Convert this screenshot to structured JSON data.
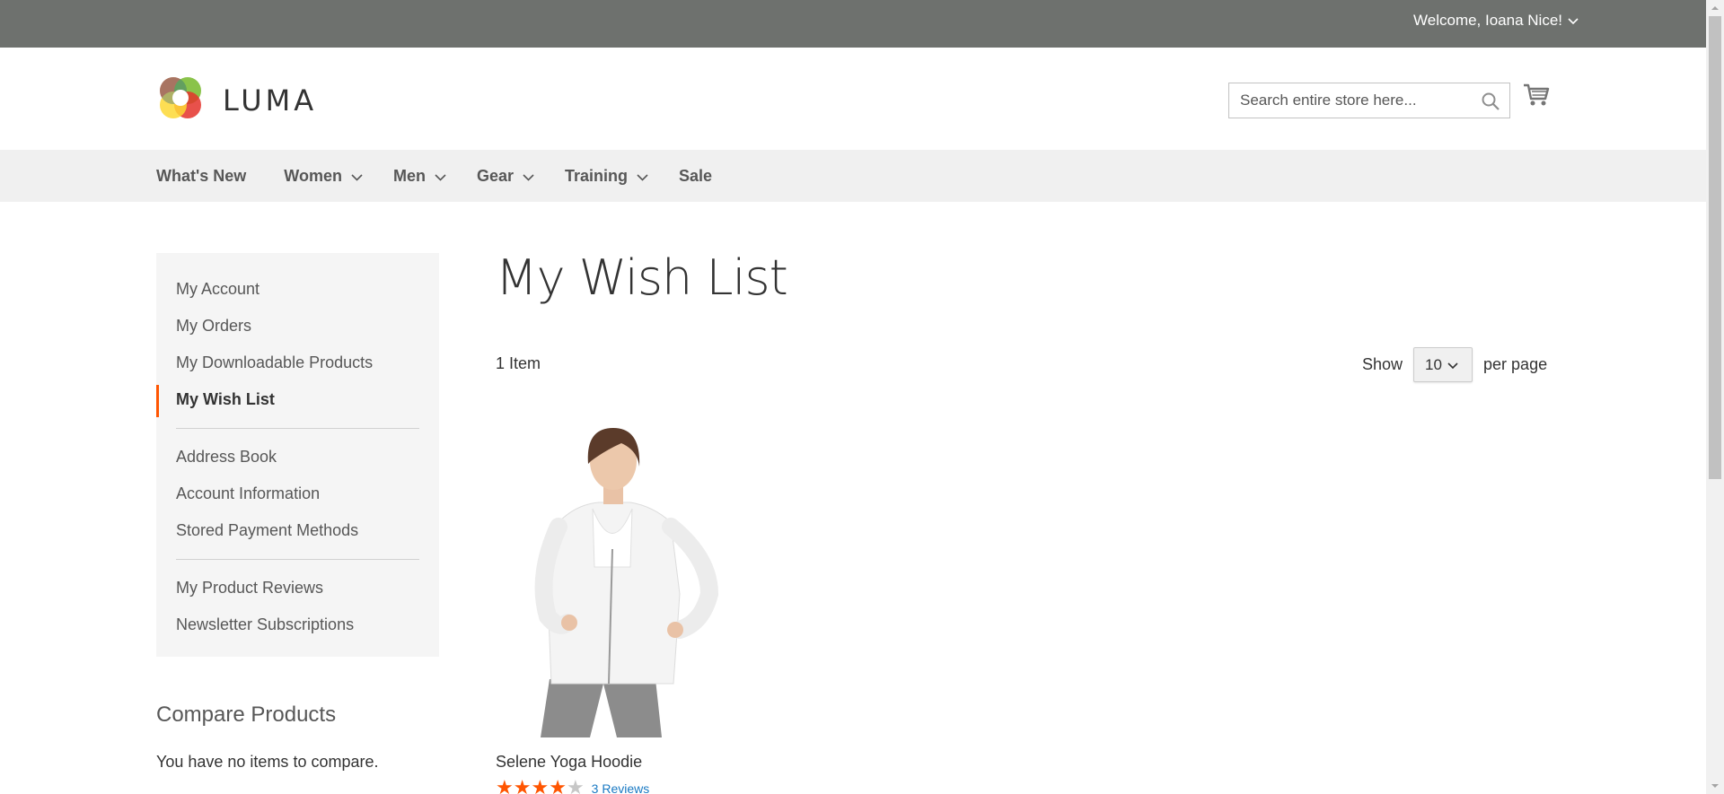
{
  "header": {
    "welcome": "Welcome, Ioana Nice!",
    "logo_text": "LUMA",
    "search_placeholder": "Search entire store here..."
  },
  "nav": {
    "items": [
      {
        "label": "What's New",
        "has_dropdown": false
      },
      {
        "label": "Women",
        "has_dropdown": true
      },
      {
        "label": "Men",
        "has_dropdown": true
      },
      {
        "label": "Gear",
        "has_dropdown": true
      },
      {
        "label": "Training",
        "has_dropdown": true
      },
      {
        "label": "Sale",
        "has_dropdown": false
      }
    ]
  },
  "sidebar": {
    "group1": [
      {
        "label": "My Account"
      },
      {
        "label": "My Orders"
      },
      {
        "label": "My Downloadable Products"
      },
      {
        "label": "My Wish List",
        "active": true
      }
    ],
    "group2": [
      {
        "label": "Address Book"
      },
      {
        "label": "Account Information"
      },
      {
        "label": "Stored Payment Methods"
      }
    ],
    "group3": [
      {
        "label": "My Product Reviews"
      },
      {
        "label": "Newsletter Subscriptions"
      }
    ]
  },
  "compare": {
    "title": "Compare Products",
    "empty": "You have no items to compare."
  },
  "main": {
    "title": "My Wish List",
    "item_count": "1 Item",
    "limiter": {
      "show_label": "Show",
      "value": "10",
      "per_page_label": "per page"
    },
    "products": [
      {
        "name": "Selene Yoga Hoodie",
        "rating_percent": 80,
        "reviews": "3 Reviews"
      }
    ]
  },
  "colors": {
    "topbar": "#6e716e",
    "accent": "#ff5501",
    "link": "#1979c3",
    "nav_bg": "#f0f0f0",
    "sidebar_bg": "#f5f5f5"
  },
  "icons": {
    "welcome_dropdown": "chevron-down-icon",
    "search": "search-icon",
    "cart": "cart-icon",
    "nav_dropdown": "chevron-down-icon",
    "limiter_dropdown": "chevron-down-icon",
    "rating": "star-icon"
  }
}
